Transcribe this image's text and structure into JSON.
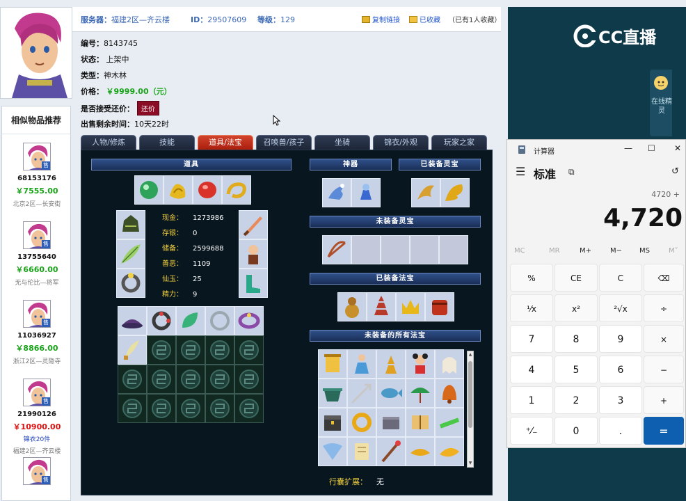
{
  "header": {
    "server_label": "服务器：",
    "server_value": "福建2区—齐云楼",
    "id_label": "ID：",
    "id_value": "29507609",
    "level_label": "等级：",
    "level_value": "129",
    "copy_link": "复制链接",
    "favorited": "已收藏",
    "fav_count": "（已有1人收藏）"
  },
  "info": {
    "number_label": "编号：",
    "number_value": "8143745",
    "status_label": "状态：",
    "status_value": "上架中",
    "type_label": "类型：",
    "type_value": "神木林",
    "price_label": "价格：",
    "price_value": "￥9999.00（元）",
    "bargain_label": "是否接受还价：",
    "bargain_button": "还价",
    "remaining_label": "出售剩余时间：",
    "remaining_value": "10天22时"
  },
  "tabs": [
    "人物/修炼",
    "技能",
    "道具/法宝",
    "召唤兽/孩子",
    "坐骑",
    "锦衣/外观",
    "玩家之家"
  ],
  "similar": {
    "title": "相似物品推荐",
    "sold_tag": "售",
    "items": [
      {
        "id": "68153176",
        "price": "￥7555.00",
        "server": "北京2区—长安街",
        "extra": ""
      },
      {
        "id": "13755640",
        "price": "￥6660.00",
        "server": "无与伦比—将军",
        "extra": ""
      },
      {
        "id": "11036927",
        "price": "￥8866.00",
        "server": "浙江2区—灵隐寺",
        "extra": ""
      },
      {
        "id": "21990126",
        "price": "￥10900.00",
        "server": "福建2区—齐云楼",
        "extra": "锦衣20件"
      },
      {
        "id": "",
        "price": "",
        "server": "",
        "extra": ""
      }
    ]
  },
  "panel": {
    "items_header": "道具",
    "artifact_header": "神器",
    "equipped_spirit_header": "已装备灵宝",
    "unequipped_spirit_header": "未装备灵宝",
    "equipped_treasure_header": "已装备法宝",
    "all_unequipped_header": "未装备的所有法宝",
    "stats": [
      {
        "label": "现金：",
        "value": "1273986"
      },
      {
        "label": "存银：",
        "value": "0"
      },
      {
        "label": "储备：",
        "value": "2599688"
      },
      {
        "label": "善恶：",
        "value": "1109"
      },
      {
        "label": "仙玉：",
        "value": "25"
      },
      {
        "label": "精力：",
        "value": "9"
      }
    ],
    "bag_label": "行囊扩展：",
    "bag_value": "无"
  },
  "side": {
    "logo": "CC直播",
    "assistant": "在线精灵"
  },
  "calculator": {
    "title": "计算器",
    "mode": "标准",
    "expression": "4720 +",
    "display": "4,720",
    "memory": [
      "MC",
      "MR",
      "M+",
      "M−",
      "MS",
      "M˅"
    ],
    "keys": [
      "%",
      "CE",
      "C",
      "⌫",
      "¹⁄x",
      "x²",
      "²√x",
      "÷",
      "7",
      "8",
      "9",
      "×",
      "4",
      "5",
      "6",
      "−",
      "1",
      "2",
      "3",
      "+",
      "⁺⁄₋",
      "0",
      ".",
      "="
    ]
  },
  "colors": {
    "accent_blue": "#3b69b5",
    "price_green": "#19a319",
    "price_red": "#e01010",
    "tab_active": "#c0321c",
    "panel_bg": "#081620",
    "calc_equals": "#0f5fb0"
  }
}
